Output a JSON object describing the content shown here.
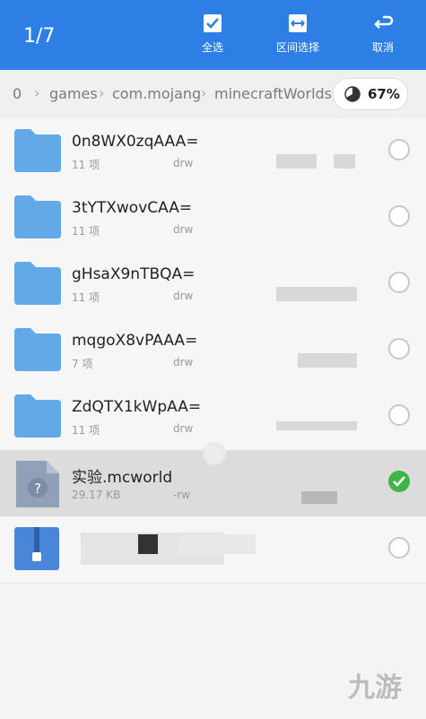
{
  "header": {
    "selection_count": "1/7",
    "actions": [
      {
        "label": "全选",
        "icon": "select-all-icon"
      },
      {
        "label": "区间选择",
        "icon": "range-select-icon"
      },
      {
        "label": "取消",
        "icon": "cancel-icon"
      }
    ]
  },
  "breadcrumb": {
    "items": [
      "0",
      "games",
      "com.mojang",
      "minecraftWorlds"
    ],
    "storage_percent": "67%",
    "storage_used_fraction": 0.67
  },
  "files": [
    {
      "name": "0n8WX0zqAAA=",
      "meta": "11 项",
      "perm": "drw",
      "type": "folder",
      "selected": false
    },
    {
      "name": "3tYTXwovCAA=",
      "meta": "11 项",
      "perm": "drw",
      "type": "folder",
      "selected": false
    },
    {
      "name": "gHsaX9nTBQA=",
      "meta": "11 项",
      "perm": "drw",
      "type": "folder",
      "selected": false
    },
    {
      "name": "mqgoX8vPAAA=",
      "meta": "7 项",
      "perm": "drw",
      "type": "folder",
      "selected": false
    },
    {
      "name": "ZdQTX1kWpAA=",
      "meta": "11 项",
      "perm": "drw",
      "type": "folder",
      "selected": false
    },
    {
      "name": "实验.mcworld",
      "meta": "29.17 KB",
      "perm": "-rw",
      "type": "unknown-file",
      "selected": true
    },
    {
      "name": "",
      "meta": "",
      "perm": "",
      "type": "zip-file",
      "selected": false
    }
  ],
  "colors": {
    "accent": "#2d7fe6",
    "check": "#3fb549",
    "folder": "#63a9e8"
  }
}
